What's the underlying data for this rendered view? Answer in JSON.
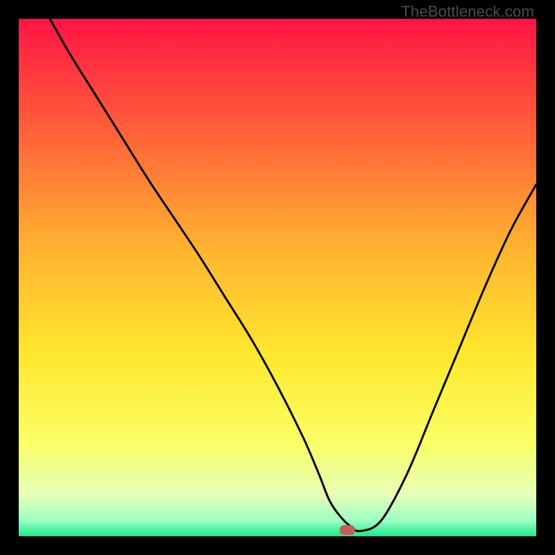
{
  "watermark": "TheBottleneck.com",
  "chart_data": {
    "type": "line",
    "title": "",
    "xlabel": "",
    "ylabel": "",
    "xlim": [
      0,
      100
    ],
    "ylim": [
      0,
      100
    ],
    "gradient_stops": [
      {
        "pos": 0.0,
        "color": "#ff1444"
      },
      {
        "pos": 0.2,
        "color": "#ff5a3a"
      },
      {
        "pos": 0.45,
        "color": "#ffb530"
      },
      {
        "pos": 0.65,
        "color": "#ffe72e"
      },
      {
        "pos": 0.82,
        "color": "#faff66"
      },
      {
        "pos": 0.92,
        "color": "#e6ffb8"
      },
      {
        "pos": 0.97,
        "color": "#9cffc4"
      },
      {
        "pos": 1.0,
        "color": "#1ae887"
      }
    ],
    "curve": {
      "x": [
        6,
        10,
        15,
        20,
        25,
        30,
        35,
        40,
        45,
        50,
        55,
        58,
        60,
        62,
        64,
        66,
        70,
        75,
        80,
        85,
        90,
        95,
        100
      ],
      "y": [
        100,
        93,
        85,
        77,
        69,
        61.5,
        54,
        46,
        38,
        29,
        19,
        12,
        7,
        4,
        2,
        1,
        3,
        12,
        24,
        36,
        48,
        59,
        68
      ]
    },
    "marker": {
      "x": 63.5,
      "y": 1.2,
      "color": "#c06058"
    }
  }
}
